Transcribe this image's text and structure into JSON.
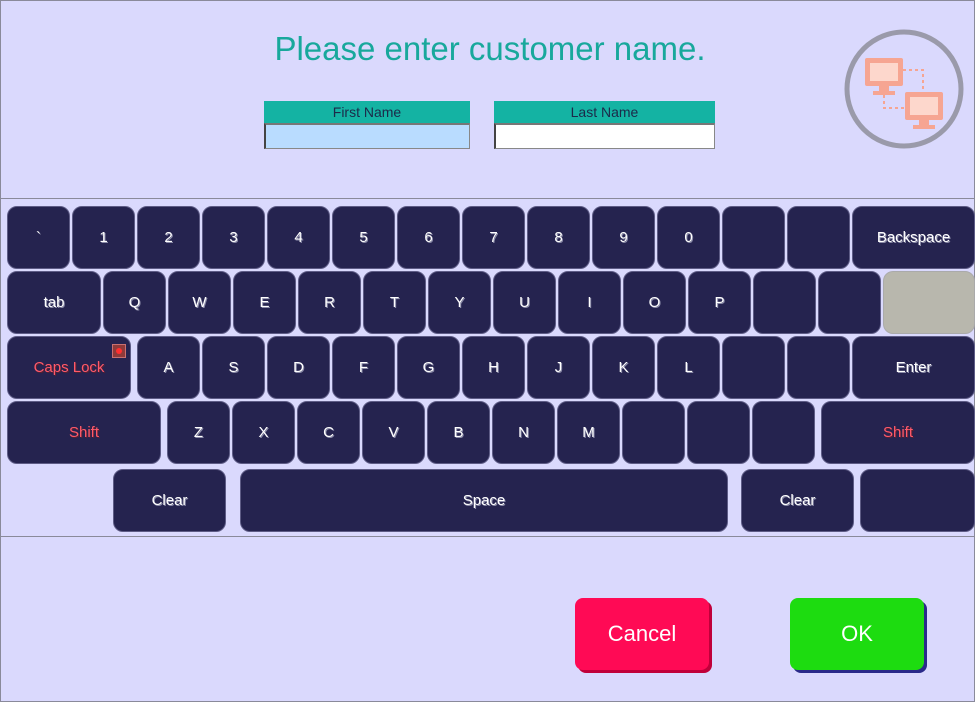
{
  "header": {
    "title": "Please enter customer name."
  },
  "fields": {
    "first_name": {
      "label": "First Name",
      "value": ""
    },
    "last_name": {
      "label": "Last Name",
      "value": ""
    }
  },
  "keyboard": {
    "row1": [
      "`",
      "1",
      "2",
      "3",
      "4",
      "5",
      "6",
      "7",
      "8",
      "9",
      "0",
      "",
      "",
      "Backspace"
    ],
    "row2": [
      "tab",
      "Q",
      "W",
      "E",
      "R",
      "T",
      "Y",
      "U",
      "I",
      "O",
      "P",
      "",
      "",
      ""
    ],
    "row3": [
      "Caps Lock",
      "A",
      "S",
      "D",
      "F",
      "G",
      "H",
      "J",
      "K",
      "L",
      "",
      "",
      "Enter"
    ],
    "row4": [
      "Shift",
      "Z",
      "X",
      "C",
      "V",
      "B",
      "N",
      "M",
      "",
      "",
      "",
      "Shift"
    ],
    "row5": [
      "Clear",
      "Space",
      "Clear",
      ""
    ]
  },
  "buttons": {
    "cancel": "Cancel",
    "ok": "OK"
  },
  "icons": {
    "network": "network-computers-icon"
  },
  "colors": {
    "background": "#dad9fd",
    "title": "#18a89c",
    "key": "#25234f",
    "cancel": "#ff0a55",
    "ok": "#1ddc10",
    "caps_indicator": "#ff3030"
  }
}
